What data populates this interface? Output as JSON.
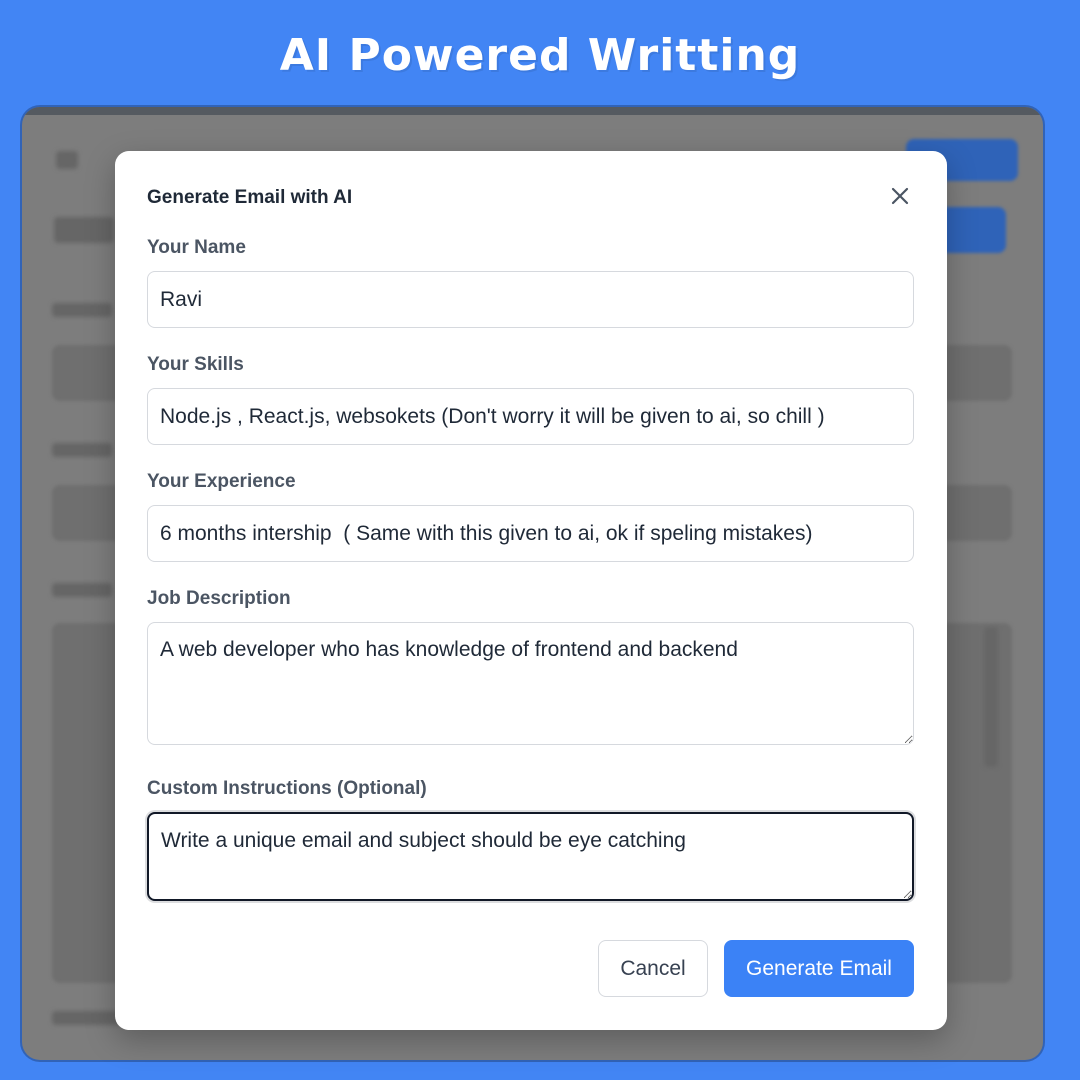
{
  "banner": {
    "title": "AI Powered Writting"
  },
  "modal": {
    "title": "Generate Email with AI",
    "fields": {
      "name": {
        "label": "Your Name",
        "value": "Ravi"
      },
      "skills": {
        "label": "Your Skills",
        "value": "Node.js , React.js, websokets (Don't worry it will be given to ai, so chill )"
      },
      "experience": {
        "label": "Your Experience",
        "value": "6 months intership  ( Same with this given to ai, ok if speling mistakes)"
      },
      "job_description": {
        "label": "Job Description",
        "value": "A web developer who has knowledge of frontend and backend"
      },
      "custom_instructions": {
        "label": "Custom Instructions (Optional)",
        "value": "Write a unique email and subject should be eye catching"
      }
    },
    "buttons": {
      "cancel": "Cancel",
      "generate": "Generate Email"
    }
  },
  "colors": {
    "background": "#4285f4",
    "primary": "#3b82f6",
    "overlay": "#7d7d7d"
  },
  "icons": {
    "close": "close-icon"
  }
}
